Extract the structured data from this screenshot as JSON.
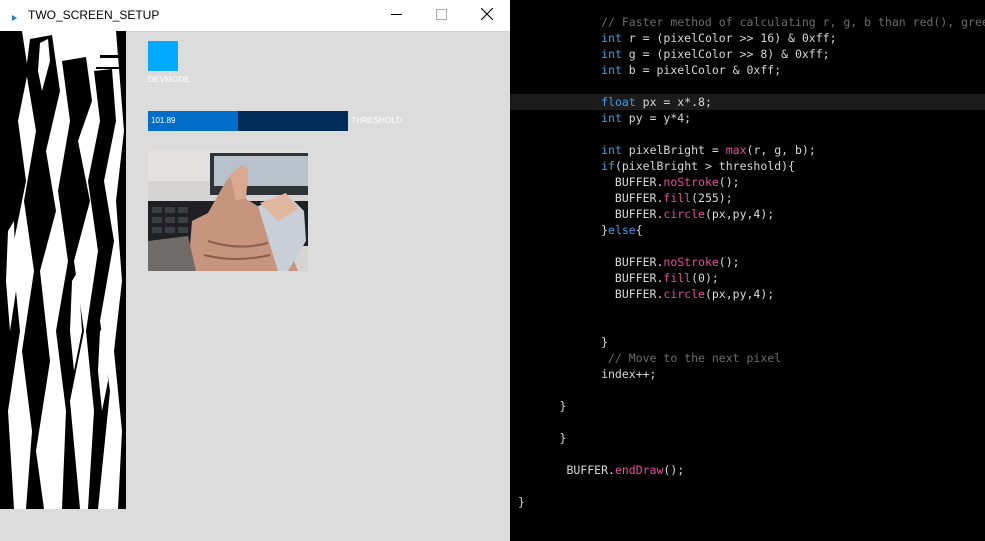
{
  "window": {
    "title": "TWO_SCREEN_SETUP"
  },
  "controls": {
    "devmode_label": "DEVMODE",
    "threshold_label": "THRESHOLD",
    "threshold_value": "101.89",
    "threshold_fraction": 0.45,
    "accent_color": "#00aaff",
    "slider_fill_color": "#006ec8",
    "slider_bg_color": "#002d5a"
  },
  "editor": {
    "lines": [
      [
        [
          "comment",
          "            // Faster method of calculating r, g, b than red(), green(), blue()"
        ]
      ],
      [
        [
          "plain",
          "            "
        ],
        [
          "type",
          "int"
        ],
        [
          "plain",
          " r = (pixelColor >> 16) & 0xff;"
        ]
      ],
      [
        [
          "plain",
          "            "
        ],
        [
          "type",
          "int"
        ],
        [
          "plain",
          " g = (pixelColor >> 8) & 0xff;"
        ]
      ],
      [
        [
          "plain",
          "            "
        ],
        [
          "type",
          "int"
        ],
        [
          "plain",
          " b = pixelColor & 0xff;"
        ]
      ],
      [
        [
          "plain",
          ""
        ]
      ],
      [
        [
          "plain",
          "            "
        ],
        [
          "type",
          "float"
        ],
        [
          "plain",
          " px = x*.8;"
        ]
      ],
      [
        [
          "plain",
          "            "
        ],
        [
          "type",
          "int"
        ],
        [
          "plain",
          " py = y*4;"
        ]
      ],
      [
        [
          "plain",
          ""
        ]
      ],
      [
        [
          "plain",
          "            "
        ],
        [
          "type",
          "int"
        ],
        [
          "plain",
          " pixelBright = "
        ],
        [
          "func",
          "max"
        ],
        [
          "plain",
          "(r, g, b);"
        ]
      ],
      [
        [
          "plain",
          "            "
        ],
        [
          "keyword",
          "if"
        ],
        [
          "plain",
          "(pixelBright > threshold){"
        ]
      ],
      [
        [
          "plain",
          "              BUFFER."
        ],
        [
          "func",
          "noStroke"
        ],
        [
          "plain",
          "();"
        ]
      ],
      [
        [
          "plain",
          "              BUFFER."
        ],
        [
          "func",
          "fill"
        ],
        [
          "plain",
          "(255);"
        ]
      ],
      [
        [
          "plain",
          "              BUFFER."
        ],
        [
          "func",
          "circle"
        ],
        [
          "plain",
          "(px,py,4);"
        ]
      ],
      [
        [
          "plain",
          "            }"
        ],
        [
          "keyword",
          "else"
        ],
        [
          "plain",
          "{"
        ]
      ],
      [
        [
          "plain",
          ""
        ]
      ],
      [
        [
          "plain",
          "              BUFFER."
        ],
        [
          "func",
          "noStroke"
        ],
        [
          "plain",
          "();"
        ]
      ],
      [
        [
          "plain",
          "              BUFFER."
        ],
        [
          "func",
          "fill"
        ],
        [
          "plain",
          "(0);"
        ]
      ],
      [
        [
          "plain",
          "              BUFFER."
        ],
        [
          "func",
          "circle"
        ],
        [
          "plain",
          "(px,py,4);"
        ]
      ],
      [
        [
          "plain",
          ""
        ]
      ],
      [
        [
          "plain",
          ""
        ]
      ],
      [
        [
          "plain",
          "            }"
        ]
      ],
      [
        [
          "comment",
          "             // Move to the next pixel"
        ]
      ],
      [
        [
          "plain",
          "            index++;"
        ]
      ],
      [
        [
          "plain",
          ""
        ]
      ],
      [
        [
          "plain",
          "      }"
        ]
      ],
      [
        [
          "plain",
          ""
        ]
      ],
      [
        [
          "plain",
          "      }"
        ]
      ],
      [
        [
          "plain",
          ""
        ]
      ],
      [
        [
          "plain",
          "       BUFFER."
        ],
        [
          "func",
          "endDraw"
        ],
        [
          "plain",
          "();"
        ]
      ],
      [
        [
          "plain",
          ""
        ]
      ],
      [
        [
          "plain",
          "}"
        ]
      ]
    ]
  }
}
